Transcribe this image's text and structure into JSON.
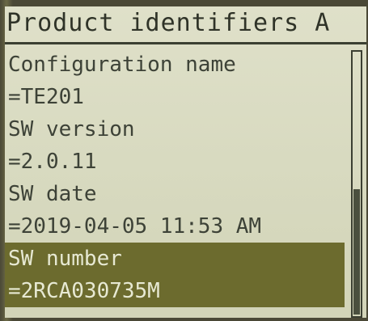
{
  "title": "Product identifiers A",
  "items": [
    {
      "label": "Configuration name",
      "value": "=TE201"
    },
    {
      "label": "SW version",
      "value": "=2.0.11"
    },
    {
      "label": "SW date",
      "value": "=2019-04-05 11:53 AM"
    },
    {
      "label": "SW number",
      "value": "=2RCA030735M",
      "selected": true
    }
  ],
  "colors": {
    "screen": "#dfe0c9",
    "text": "#3d4237",
    "highlight": "#6c6b2e",
    "highlight_text": "#e7e9d3"
  }
}
